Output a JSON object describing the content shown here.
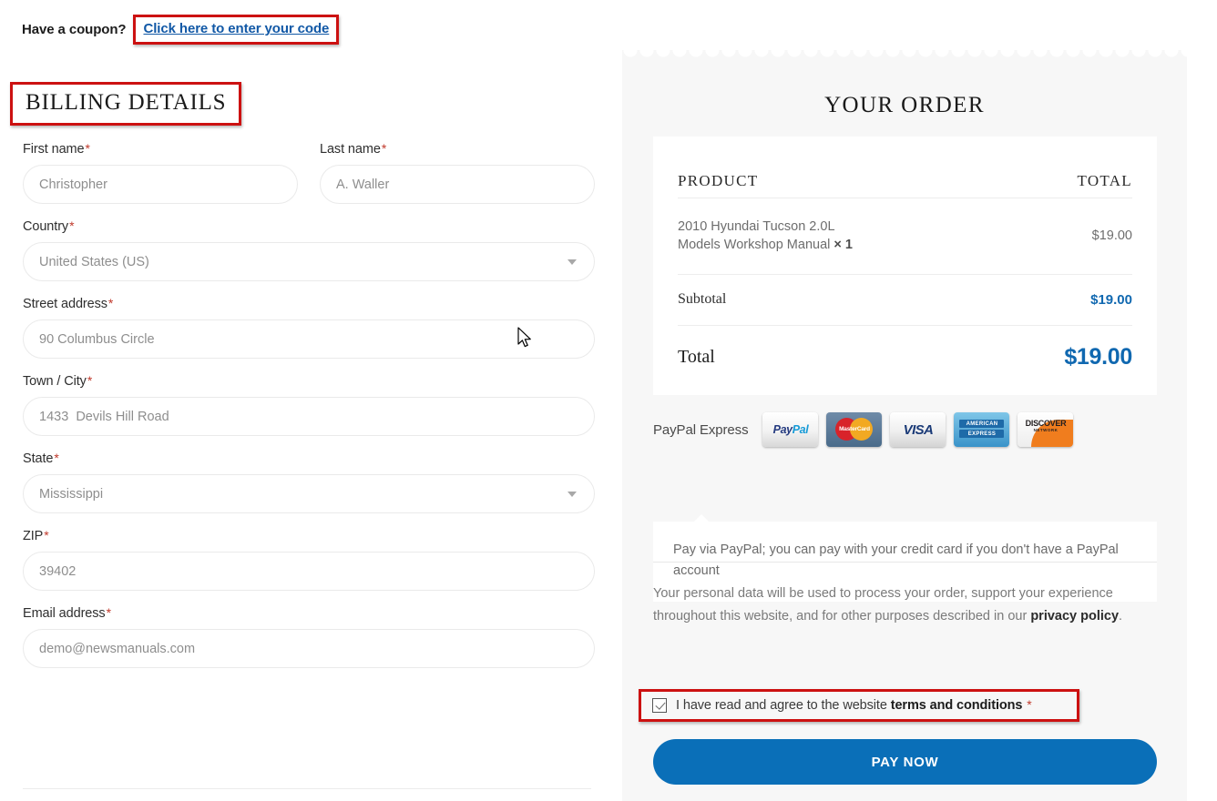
{
  "coupon": {
    "label": "Have a coupon?",
    "link_text": "Click here to enter your code"
  },
  "billing": {
    "heading": "BILLING DETAILS",
    "required_mark": "*",
    "fields": [
      {
        "label": "First name",
        "value": "Christopher",
        "type": "text"
      },
      {
        "label": "Last name",
        "value": "A. Waller",
        "type": "text"
      },
      {
        "label": "Country",
        "value": "United States (US)",
        "type": "select"
      },
      {
        "label": "Street address",
        "value": "90 Columbus Circle",
        "type": "text"
      },
      {
        "label": "Town / City",
        "value": "1433  Devils Hill Road",
        "type": "text"
      },
      {
        "label": "State",
        "value": "Mississippi",
        "type": "select"
      },
      {
        "label": "ZIP",
        "value": "39402",
        "type": "text"
      },
      {
        "label": "Email address",
        "value": "demo@newsmanuals.com",
        "type": "email"
      }
    ]
  },
  "order": {
    "title": "YOUR ORDER",
    "columns": {
      "product": "PRODUCT",
      "total": "TOTAL"
    },
    "items": [
      {
        "name_line1": "2010 Hyundai Tucson 2.0L",
        "name_line2": "Models Workshop Manual",
        "quantity": "× 1",
        "price": "$19.00"
      }
    ],
    "subtotal_label": "Subtotal",
    "subtotal_value": "$19.00",
    "total_label": "Total",
    "total_value": "$19.00",
    "accent_color": "#1068b0"
  },
  "payment": {
    "method_label": "PayPal Express",
    "cards": [
      {
        "name": "paypal-card-icon",
        "text1": "Pay",
        "text2": "Pal"
      },
      {
        "name": "mastercard-card-icon",
        "text": "MasterCard"
      },
      {
        "name": "visa-card-icon",
        "text": "VISA"
      },
      {
        "name": "amex-card-icon",
        "line1": "AMERICAN",
        "line2": "EXPRESS"
      },
      {
        "name": "discover-card-icon",
        "line1": "DISCOVER",
        "line2": "NETWORK"
      }
    ],
    "description": "Pay via PayPal; you can pay with your credit card if you don't have a PayPal account"
  },
  "privacy": {
    "text_before": "Your personal data will be used to process your order, support your experience throughout this website, and for other purposes described in our ",
    "link": "privacy policy",
    "text_after": "."
  },
  "terms": {
    "checked": true,
    "text_before": "I have read and agree to the website ",
    "link": "terms and conditions",
    "required_mark": "*"
  },
  "actions": {
    "pay_now": "PAY NOW",
    "button_color": "#0a6fb8"
  },
  "annotations": {
    "color": "#cc1111",
    "boxes": [
      "coupon-link",
      "billing-heading",
      "terms-checkbox-row"
    ]
  }
}
